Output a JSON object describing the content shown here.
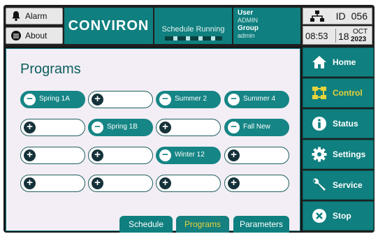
{
  "header": {
    "alarm_label": "Alarm",
    "about_label": "About",
    "brand": "CONVIRON",
    "schedule_status": "Schedule Running",
    "user_label": "User",
    "user_value": "ADMIN",
    "group_label": "Group",
    "group_value": "admin",
    "id_label": "ID",
    "id_value": "056",
    "time": "08:53",
    "day": "18",
    "month": "OCT",
    "year": "2023"
  },
  "main": {
    "title": "Programs",
    "programs": [
      {
        "name": "Spring 1A",
        "state": "filled",
        "icon": "minus-icon"
      },
      {
        "name": "",
        "state": "empty",
        "icon": "plus-icon"
      },
      {
        "name": "Summer 2",
        "state": "filled",
        "icon": "minus-icon"
      },
      {
        "name": "Summer 4",
        "state": "filled",
        "icon": "minus-icon"
      },
      {
        "name": "",
        "state": "empty",
        "icon": "plus-icon"
      },
      {
        "name": "Spring 1B",
        "state": "filled",
        "icon": "minus-icon"
      },
      {
        "name": "",
        "state": "empty",
        "icon": "plus-icon"
      },
      {
        "name": "Fall New",
        "state": "filled",
        "icon": "minus-icon"
      },
      {
        "name": "",
        "state": "empty",
        "icon": "plus-icon"
      },
      {
        "name": "",
        "state": "empty",
        "icon": "plus-icon"
      },
      {
        "name": "Winter 12",
        "state": "filled",
        "icon": "minus-icon"
      },
      {
        "name": "",
        "state": "empty",
        "icon": "plus-icon"
      },
      {
        "name": "",
        "state": "empty",
        "icon": "plus-icon"
      },
      {
        "name": "",
        "state": "empty",
        "icon": "plus-icon"
      },
      {
        "name": "",
        "state": "empty",
        "icon": "plus-icon"
      },
      {
        "name": "",
        "state": "empty",
        "icon": "plus-icon"
      }
    ],
    "tabs": [
      {
        "label": "Schedule",
        "active": false
      },
      {
        "label": "Programs",
        "active": true
      },
      {
        "label": "Parameters",
        "active": false
      }
    ]
  },
  "nav": {
    "items": [
      {
        "label": "Home",
        "icon": "home-icon",
        "active": false
      },
      {
        "label": "Control",
        "icon": "control-icon",
        "active": true
      },
      {
        "label": "Status",
        "icon": "info-icon",
        "active": false
      },
      {
        "label": "Settings",
        "icon": "gear-icon",
        "active": false
      },
      {
        "label": "Service",
        "icon": "wrench-icon",
        "active": false
      },
      {
        "label": "Stop",
        "icon": "stop-icon",
        "active": false
      }
    ]
  },
  "colors": {
    "teal": "#0f7f7f",
    "active_text": "#e6d23a",
    "panel_bg": "#f3eef5"
  }
}
